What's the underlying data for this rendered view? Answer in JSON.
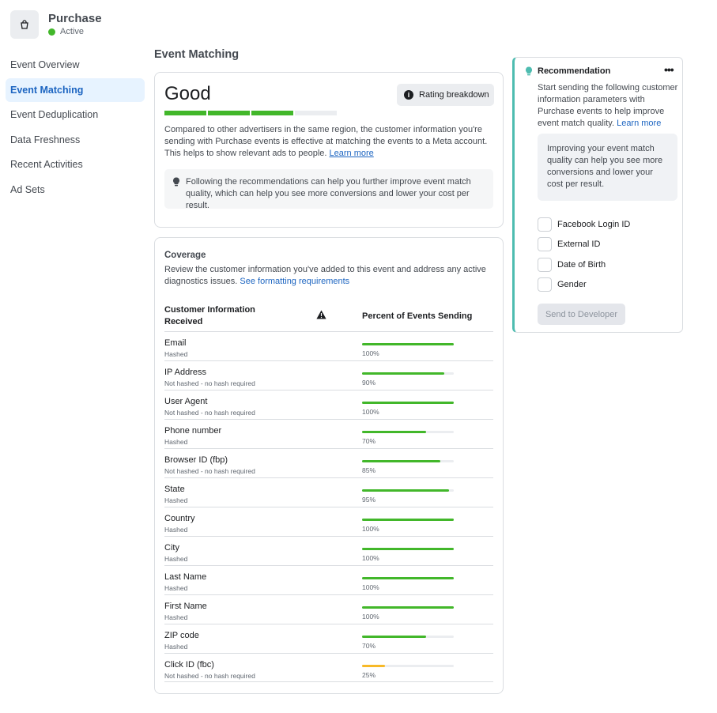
{
  "header": {
    "title": "Purchase",
    "status": "Active",
    "status_color": "#42b72a",
    "icon": "shopping-bag-icon"
  },
  "sidebar": {
    "items": [
      {
        "label": "Event Overview",
        "active": false
      },
      {
        "label": "Event Matching",
        "active": true
      },
      {
        "label": "Event Deduplication",
        "active": false
      },
      {
        "label": "Data Freshness",
        "active": false
      },
      {
        "label": "Recent Activities",
        "active": false
      },
      {
        "label": "Ad Sets",
        "active": false
      }
    ]
  },
  "main": {
    "title": "Event Matching",
    "rating": {
      "label": "Good",
      "breakdown_label": "Rating breakdown",
      "score_segments_filled": 3,
      "score_segments_total": 4,
      "description": "Compared to other advertisers in the same region, the customer information you're sending with Purchase events is effective at matching the events to a Meta account. This helps to show relevant ads to people.",
      "learn_more": "Learn more",
      "tip": "Following the recommendations can help you further improve event match quality, which can help you see more conversions and lower your cost per result."
    },
    "coverage": {
      "title": "Coverage",
      "description": "Review the customer information you've added to this event and address any active diagnostics issues.",
      "link": "See formatting requirements",
      "col1": "Customer Information Received",
      "col2": "Percent of Events Sending",
      "rows": [
        {
          "name": "Email",
          "hash": "Hashed",
          "pct": 100,
          "pct_label": "100%",
          "color": "#42b72a"
        },
        {
          "name": "IP Address",
          "hash": "Not hashed - no hash required",
          "pct": 90,
          "pct_label": "90%",
          "color": "#42b72a"
        },
        {
          "name": "User Agent",
          "hash": "Not hashed - no hash required",
          "pct": 100,
          "pct_label": "100%",
          "color": "#42b72a"
        },
        {
          "name": "Phone number",
          "hash": "Hashed",
          "pct": 70,
          "pct_label": "70%",
          "color": "#42b72a"
        },
        {
          "name": "Browser ID (fbp)",
          "hash": "Not hashed - no hash required",
          "pct": 85,
          "pct_label": "85%",
          "color": "#42b72a"
        },
        {
          "name": "State",
          "hash": "Hashed",
          "pct": 95,
          "pct_label": "95%",
          "color": "#42b72a"
        },
        {
          "name": "Country",
          "hash": "Hashed",
          "pct": 100,
          "pct_label": "100%",
          "color": "#42b72a"
        },
        {
          "name": "City",
          "hash": "Hashed",
          "pct": 100,
          "pct_label": "100%",
          "color": "#42b72a"
        },
        {
          "name": "Last Name",
          "hash": "Hashed",
          "pct": 100,
          "pct_label": "100%",
          "color": "#42b72a"
        },
        {
          "name": "First Name",
          "hash": "Hashed",
          "pct": 100,
          "pct_label": "100%",
          "color": "#42b72a"
        },
        {
          "name": "ZIP code",
          "hash": "Hashed",
          "pct": 70,
          "pct_label": "70%",
          "color": "#42b72a"
        },
        {
          "name": "Click ID (fbc)",
          "hash": "Not hashed - no hash required",
          "pct": 25,
          "pct_label": "25%",
          "color": "#f7b928"
        }
      ]
    }
  },
  "recommendation": {
    "title": "Recommendation",
    "more": "•••",
    "description": "Start sending the following customer information parameters with Purchase events to help improve event match quality.",
    "learn_more": "Learn more",
    "box_text": "Improving your event match quality can help you see more conversions and lower your cost per result.",
    "params": [
      "Facebook Login ID",
      "External ID",
      "Date of Birth",
      "Gender"
    ],
    "send_button": "Send to Developer",
    "accent": "#4ebcb0"
  }
}
